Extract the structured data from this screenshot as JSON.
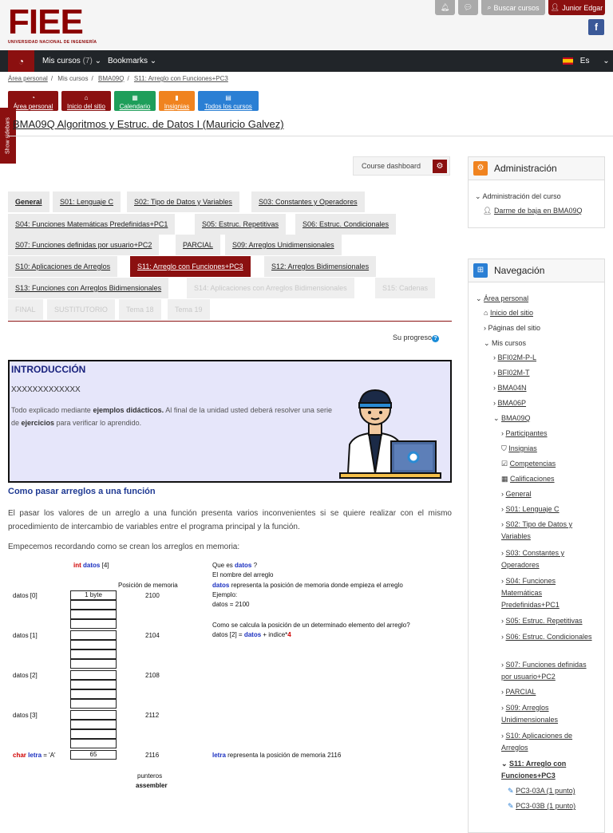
{
  "header": {
    "logo_text": "FIEE",
    "logo_sub": "UNIVERSIDAD NACIONAL DE INGENIERÍA",
    "btn_bell_icon": "bell-icon",
    "btn_chat_icon": "chat-icon",
    "search_label": "Buscar cursos",
    "user_label": "Junior Edgar",
    "facebook": "f"
  },
  "nav": {
    "mis_cursos": "Mis cursos",
    "mis_cursos_count": "(7)",
    "bookmarks": "Bookmarks",
    "lang": "Es"
  },
  "breadcrumb": [
    "Área personal",
    "Mis cursos",
    "BMA09Q",
    "S11: Arreglo con Funciones+PC3"
  ],
  "quick": [
    {
      "label": "Área personal",
      "color": "#8b1010"
    },
    {
      "label": "Inicio del sitio",
      "color": "#8b1010"
    },
    {
      "label": "Calendario",
      "color": "#1e9e5a"
    },
    {
      "label": "Insignias",
      "color": "#f0831f"
    },
    {
      "label": "Todos los cursos",
      "color": "#2a7fd4"
    }
  ],
  "show_sidebars": "Show sidebars",
  "course_title": "BMA09Q Algoritmos y Estruc. de Datos I (Mauricio Galvez)",
  "dashboard_label": "Course dashboard",
  "tabs": [
    "General",
    "S01: Lenguaje C",
    "S02: Tipo de Datos y Variables",
    "S03: Constantes y Operadores",
    "S04: Funciones Matemáticas Predefinidas+PC1",
    "S05: Estruc. Repetitivas",
    "S06: Estruc. Condicionales",
    "S07: Funciones definidas por usuario+PC2",
    "PARCIAL",
    "S09: Arreglos Unidimensionales",
    "S10: Aplicaciones de Arreglos",
    "S11: Arreglo con Funciones+PC3",
    "S12: Arreglos Bidimensionales",
    "S13: Funciones con Arreglos Bidimensionales",
    "S14: Aplicaciones con Arreglos Bidimensionales",
    "S15: Cadenas",
    "FINAL",
    "SUSTITUTORIO",
    "Tema 18",
    "Tema 19"
  ],
  "progress": "Su progreso",
  "intro": {
    "heading": "INTRODUCCIÓN",
    "xs": "XXXXXXXXXXXXX",
    "p1": "Todo explicado mediante ",
    "p1b": "ejemplos didácticos.",
    "p2": " Al final de la unidad usted deberá resolver una serie de ",
    "p2b": "ejercicios",
    "p3": " para verificar lo aprendido."
  },
  "article": {
    "heading": "Como pasar arreglos a una función",
    "para1": "El pasar los valores de un arreglo a una función presenta varios inconvenientes si se quiere realizar con el mismo procedimiento de intercambio de variables entre el programa principal y la función.",
    "para2": "Empecemos recordando como se crean los arreglos en memoria:"
  },
  "table": {
    "decl_int": "int",
    "decl_datos": "datos",
    "decl_size": "[4]",
    "col_pos": "Posición de memoria",
    "rows": [
      {
        "label": "datos [0]",
        "val": "1 byte",
        "addr": "2100"
      },
      {
        "label": "datos [1]",
        "val": "",
        "addr": "2104"
      },
      {
        "label": "datos [2]",
        "val": "",
        "addr": "2108"
      },
      {
        "label": "datos [3]",
        "val": "",
        "addr": "2112"
      }
    ],
    "char_kw": "char",
    "char_var": "letra",
    "char_eq": " = 'A'",
    "char_val": "65",
    "char_addr": "2116",
    "punteros": "punteros",
    "assembler": "assembler",
    "q1a": "Que es ",
    "q1b": "datos",
    "q1c": " ?",
    "n1": "El nombre del arreglo",
    "n2a": "datos",
    "n2b": " representa la posición de memoria donde empieza el arreglo",
    "ej": "Ejemplo:",
    "ej2": "datos = 2100",
    "q2": "Como se calcula la posición de un determinado elemento del arreglo?",
    "f1": "datos [2] = ",
    "f2": "datos",
    "f3": " + indice*",
    "f4": "4",
    "l1": "letra",
    "l2": " representa la posición de memoria 2116"
  },
  "admin": {
    "title": "Administración",
    "items": [
      "Administración del curso",
      "Darme de baja en BMA09Q"
    ]
  },
  "navblock": {
    "title": "Navegación",
    "items": [
      "Área personal",
      "Inicio del sitio",
      "Páginas del sitio",
      "Mis cursos",
      "BFI02M-P-L",
      "BFI02M-T",
      "BMA04N",
      "BMA06P",
      "BMA09Q",
      "Participantes",
      "Insignias",
      "Competencias",
      "Calificaciones",
      "General",
      "S01: Lenguaje C",
      "S02: Tipo de Datos y Variables",
      "S03: Constantes y Operadores",
      "S04: Funciones Matemáticas Predefinidas+PC1",
      "S05: Estruc. Repetitivas",
      "S06: Estruc. Condicionales",
      "S07: Funciones definidas por usuario+PC2",
      "PARCIAL",
      "S09: Arreglos Unidimensionales",
      "S10: Aplicaciones de Arreglos",
      "S11: Arreglo con Funciones+PC3",
      "PC3-03A (1 punto)",
      "PC3-03B (1 punto)"
    ]
  }
}
